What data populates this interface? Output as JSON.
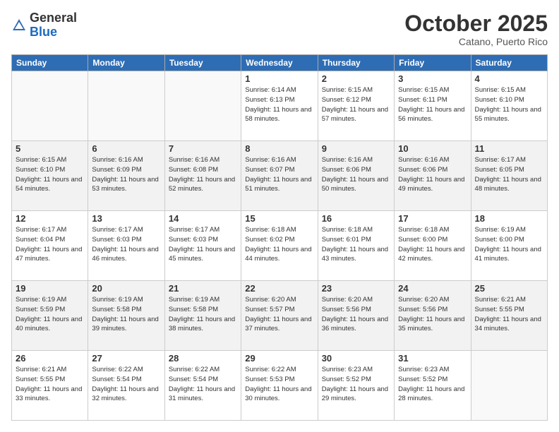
{
  "header": {
    "logo_general": "General",
    "logo_blue": "Blue",
    "month": "October 2025",
    "location": "Catano, Puerto Rico"
  },
  "days_of_week": [
    "Sunday",
    "Monday",
    "Tuesday",
    "Wednesday",
    "Thursday",
    "Friday",
    "Saturday"
  ],
  "weeks": [
    [
      {
        "day": "",
        "info": ""
      },
      {
        "day": "",
        "info": ""
      },
      {
        "day": "",
        "info": ""
      },
      {
        "day": "1",
        "info": "Sunrise: 6:14 AM\nSunset: 6:13 PM\nDaylight: 11 hours\nand 58 minutes."
      },
      {
        "day": "2",
        "info": "Sunrise: 6:15 AM\nSunset: 6:12 PM\nDaylight: 11 hours\nand 57 minutes."
      },
      {
        "day": "3",
        "info": "Sunrise: 6:15 AM\nSunset: 6:11 PM\nDaylight: 11 hours\nand 56 minutes."
      },
      {
        "day": "4",
        "info": "Sunrise: 6:15 AM\nSunset: 6:10 PM\nDaylight: 11 hours\nand 55 minutes."
      }
    ],
    [
      {
        "day": "5",
        "info": "Sunrise: 6:15 AM\nSunset: 6:10 PM\nDaylight: 11 hours\nand 54 minutes."
      },
      {
        "day": "6",
        "info": "Sunrise: 6:16 AM\nSunset: 6:09 PM\nDaylight: 11 hours\nand 53 minutes."
      },
      {
        "day": "7",
        "info": "Sunrise: 6:16 AM\nSunset: 6:08 PM\nDaylight: 11 hours\nand 52 minutes."
      },
      {
        "day": "8",
        "info": "Sunrise: 6:16 AM\nSunset: 6:07 PM\nDaylight: 11 hours\nand 51 minutes."
      },
      {
        "day": "9",
        "info": "Sunrise: 6:16 AM\nSunset: 6:06 PM\nDaylight: 11 hours\nand 50 minutes."
      },
      {
        "day": "10",
        "info": "Sunrise: 6:16 AM\nSunset: 6:06 PM\nDaylight: 11 hours\nand 49 minutes."
      },
      {
        "day": "11",
        "info": "Sunrise: 6:17 AM\nSunset: 6:05 PM\nDaylight: 11 hours\nand 48 minutes."
      }
    ],
    [
      {
        "day": "12",
        "info": "Sunrise: 6:17 AM\nSunset: 6:04 PM\nDaylight: 11 hours\nand 47 minutes."
      },
      {
        "day": "13",
        "info": "Sunrise: 6:17 AM\nSunset: 6:03 PM\nDaylight: 11 hours\nand 46 minutes."
      },
      {
        "day": "14",
        "info": "Sunrise: 6:17 AM\nSunset: 6:03 PM\nDaylight: 11 hours\nand 45 minutes."
      },
      {
        "day": "15",
        "info": "Sunrise: 6:18 AM\nSunset: 6:02 PM\nDaylight: 11 hours\nand 44 minutes."
      },
      {
        "day": "16",
        "info": "Sunrise: 6:18 AM\nSunset: 6:01 PM\nDaylight: 11 hours\nand 43 minutes."
      },
      {
        "day": "17",
        "info": "Sunrise: 6:18 AM\nSunset: 6:00 PM\nDaylight: 11 hours\nand 42 minutes."
      },
      {
        "day": "18",
        "info": "Sunrise: 6:19 AM\nSunset: 6:00 PM\nDaylight: 11 hours\nand 41 minutes."
      }
    ],
    [
      {
        "day": "19",
        "info": "Sunrise: 6:19 AM\nSunset: 5:59 PM\nDaylight: 11 hours\nand 40 minutes."
      },
      {
        "day": "20",
        "info": "Sunrise: 6:19 AM\nSunset: 5:58 PM\nDaylight: 11 hours\nand 39 minutes."
      },
      {
        "day": "21",
        "info": "Sunrise: 6:19 AM\nSunset: 5:58 PM\nDaylight: 11 hours\nand 38 minutes."
      },
      {
        "day": "22",
        "info": "Sunrise: 6:20 AM\nSunset: 5:57 PM\nDaylight: 11 hours\nand 37 minutes."
      },
      {
        "day": "23",
        "info": "Sunrise: 6:20 AM\nSunset: 5:56 PM\nDaylight: 11 hours\nand 36 minutes."
      },
      {
        "day": "24",
        "info": "Sunrise: 6:20 AM\nSunset: 5:56 PM\nDaylight: 11 hours\nand 35 minutes."
      },
      {
        "day": "25",
        "info": "Sunrise: 6:21 AM\nSunset: 5:55 PM\nDaylight: 11 hours\nand 34 minutes."
      }
    ],
    [
      {
        "day": "26",
        "info": "Sunrise: 6:21 AM\nSunset: 5:55 PM\nDaylight: 11 hours\nand 33 minutes."
      },
      {
        "day": "27",
        "info": "Sunrise: 6:22 AM\nSunset: 5:54 PM\nDaylight: 11 hours\nand 32 minutes."
      },
      {
        "day": "28",
        "info": "Sunrise: 6:22 AM\nSunset: 5:54 PM\nDaylight: 11 hours\nand 31 minutes."
      },
      {
        "day": "29",
        "info": "Sunrise: 6:22 AM\nSunset: 5:53 PM\nDaylight: 11 hours\nand 30 minutes."
      },
      {
        "day": "30",
        "info": "Sunrise: 6:23 AM\nSunset: 5:52 PM\nDaylight: 11 hours\nand 29 minutes."
      },
      {
        "day": "31",
        "info": "Sunrise: 6:23 AM\nSunset: 5:52 PM\nDaylight: 11 hours\nand 28 minutes."
      },
      {
        "day": "",
        "info": ""
      }
    ]
  ]
}
